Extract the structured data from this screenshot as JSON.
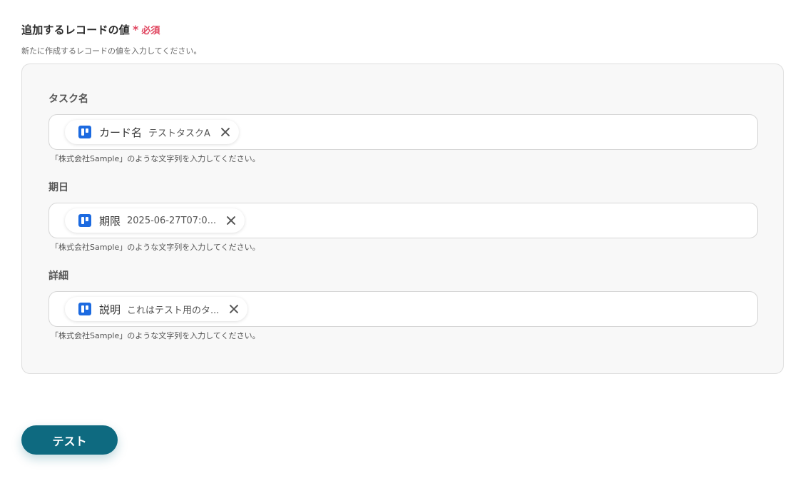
{
  "section": {
    "title": "追加するレコードの値",
    "required_mark": "*",
    "required_text": "必須",
    "description": "新たに作成するレコードの値を入力してください。"
  },
  "fields": [
    {
      "label": "タスク名",
      "chip": {
        "icon": "trello-icon",
        "name": "カード名",
        "value": "テストタスクA"
      },
      "hint": "「株式会社Sample」のような文字列を入力してください。"
    },
    {
      "label": "期日",
      "chip": {
        "icon": "trello-icon",
        "name": "期限",
        "value": "2025-06-27T07:0..."
      },
      "hint": "「株式会社Sample」のような文字列を入力してください。"
    },
    {
      "label": "詳細",
      "chip": {
        "icon": "trello-icon",
        "name": "説明",
        "value": "これはテスト用のタ..."
      },
      "hint": "「株式会社Sample」のような文字列を入力してください。"
    }
  ],
  "actions": {
    "test_label": "テスト"
  },
  "colors": {
    "accent": "#0e6a80",
    "required": "#e0455f",
    "trello": "#1c6ae0"
  }
}
